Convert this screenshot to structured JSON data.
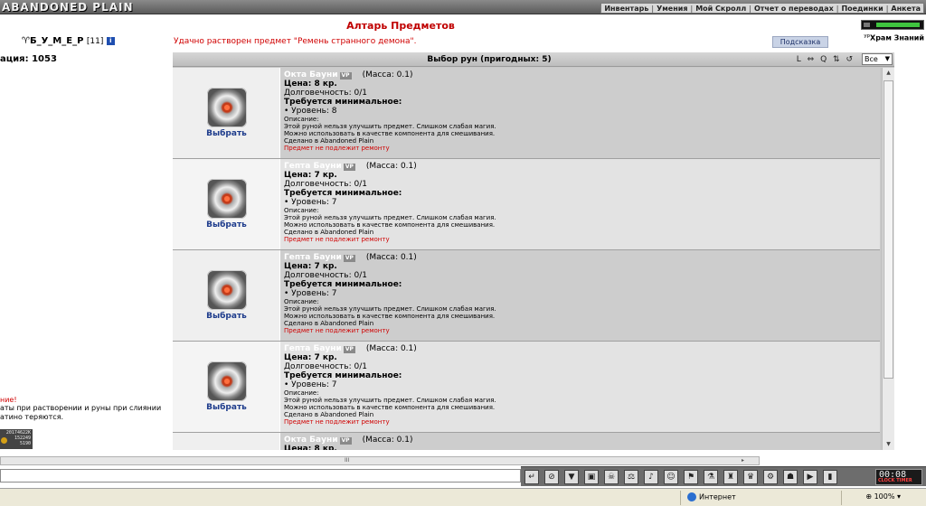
{
  "top": {
    "logo": "ABANDONED PLAIN",
    "nav": [
      "Инвентарь",
      "Умения",
      "Мой Скролл",
      "Отчет о переводах",
      "Поединки",
      "Анкета"
    ]
  },
  "player": {
    "name": "Б_У_М_Е_Р",
    "level": "[11]",
    "info": "i",
    "reputation": "ация: 1053"
  },
  "left_notes": {
    "warn_red": "ние!",
    "warn_text": "аты при растворении и руны при слиянии атино теряются.",
    "mini": [
      "20174622К",
      "152249",
      "5190"
    ]
  },
  "header": {
    "title": "Алтарь Предметов",
    "success": "Удачно растворен предмет \"Ремень странного демона\".",
    "hint_label": "Подсказка",
    "hram_label": "Храм Знаний",
    "hram_sup": "ур"
  },
  "panel": {
    "title": "Выбор рун (пригодных: 5)",
    "tools": [
      "L",
      "⇔",
      "Q",
      "⇅",
      "↺"
    ],
    "filter": "Все"
  },
  "items": [
    {
      "name": "Окта Бауни",
      "badge": "VP",
      "mass": "(Масса: 0.1)",
      "price": "Цена: 8 кр.",
      "durability": "Долговечность: 0/1",
      "req_title": "Требуется минимальное:",
      "req_level": "• Уровень: 8",
      "desc_title": "Описание:",
      "desc1": "Этой руной нельзя улучшить предмет. Слишком слабая магия.",
      "desc2": "Можно использовать в качестве компонента для смешивания.",
      "made": "Сделано в Abandoned Plain",
      "repair": "Предмет не подлежит ремонту",
      "choose": "Выбрать"
    },
    {
      "name": "Гепта Бауни",
      "badge": "VP",
      "mass": "(Масса: 0.1)",
      "price": "Цена: 7 кр.",
      "durability": "Долговечность: 0/1",
      "req_title": "Требуется минимальное:",
      "req_level": "• Уровень: 7",
      "desc_title": "Описание:",
      "desc1": "Этой руной нельзя улучшить предмет. Слишком слабая магия.",
      "desc2": "Можно использовать в качестве компонента для смешивания.",
      "made": "Сделано в Abandoned Plain",
      "repair": "Предмет не подлежит ремонту",
      "choose": "Выбрать"
    },
    {
      "name": "Гепта Бауни",
      "badge": "VP",
      "mass": "(Масса: 0.1)",
      "price": "Цена: 7 кр.",
      "durability": "Долговечность: 0/1",
      "req_title": "Требуется минимальное:",
      "req_level": "• Уровень: 7",
      "desc_title": "Описание:",
      "desc1": "Этой руной нельзя улучшить предмет. Слишком слабая магия.",
      "desc2": "Можно использовать в качестве компонента для смешивания.",
      "made": "Сделано в Abandoned Plain",
      "repair": "Предмет не подлежит ремонту",
      "choose": "Выбрать"
    },
    {
      "name": "Гепта Бауни",
      "badge": "VP",
      "mass": "(Масса: 0.1)",
      "price": "Цена: 7 кр.",
      "durability": "Долговечность: 0/1",
      "req_title": "Требуется минимальное:",
      "req_level": "• Уровень: 7",
      "desc_title": "Описание:",
      "desc1": "Этой руной нельзя улучшить предмет. Слишком слабая магия.",
      "desc2": "Можно использовать в качестве компонента для смешивания.",
      "made": "Сделано в Abandoned Plain",
      "repair": "Предмет не подлежит ремонту",
      "choose": "Выбрать"
    },
    {
      "name": "Окта Бауни",
      "badge": "VP",
      "mass": "(Масса: 0.1)",
      "price": "Цена: 8 кр.",
      "durability": "",
      "req_title": "",
      "req_level": "",
      "desc_title": "",
      "desc1": "",
      "desc2": "",
      "made": "",
      "repair": "",
      "choose": ""
    }
  ],
  "chat": {
    "hscroll_mid": "III",
    "hscroll_arrow": "▸",
    "icons": [
      "↵",
      "⊘",
      "▼",
      "▣",
      "☠",
      "⚖",
      "♪",
      "☺",
      "⚑",
      "⚗",
      "♜",
      "♛",
      "⚙",
      "☗",
      "▶",
      "▮"
    ],
    "clock_time": "00:08",
    "clock_label": "CLOCK TIMER"
  },
  "status": {
    "zone": "Интернет",
    "zoom": "100%"
  }
}
